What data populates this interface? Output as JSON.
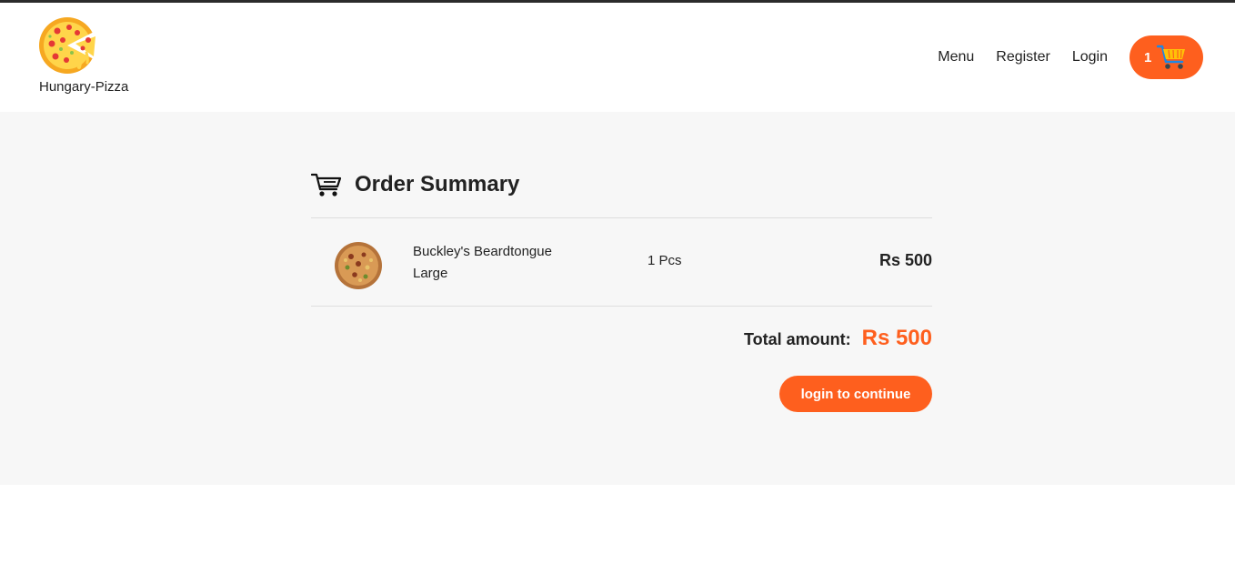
{
  "brand": {
    "name": "Hungary-Pizza",
    "logo_icon": "pizza-logo-icon"
  },
  "nav": {
    "links": [
      "Menu",
      "Register",
      "Login"
    ],
    "cart_count": "1",
    "cart_icon": "shopping-cart-icon"
  },
  "summary": {
    "title": "Order Summary",
    "title_icon": "cart-outline-icon",
    "items": [
      {
        "name_line1": "Buckley's Beardtongue",
        "name_line2": "Large",
        "qty": "1 Pcs",
        "price": "Rs 500",
        "image_icon": "pizza-thumbnail-icon"
      }
    ],
    "total_label": "Total amount:",
    "total_value": "Rs 500",
    "cta_label": "login to continue"
  },
  "colors": {
    "accent": "#fe5f1e",
    "background_section": "#f7f7f7",
    "text": "#222222"
  }
}
